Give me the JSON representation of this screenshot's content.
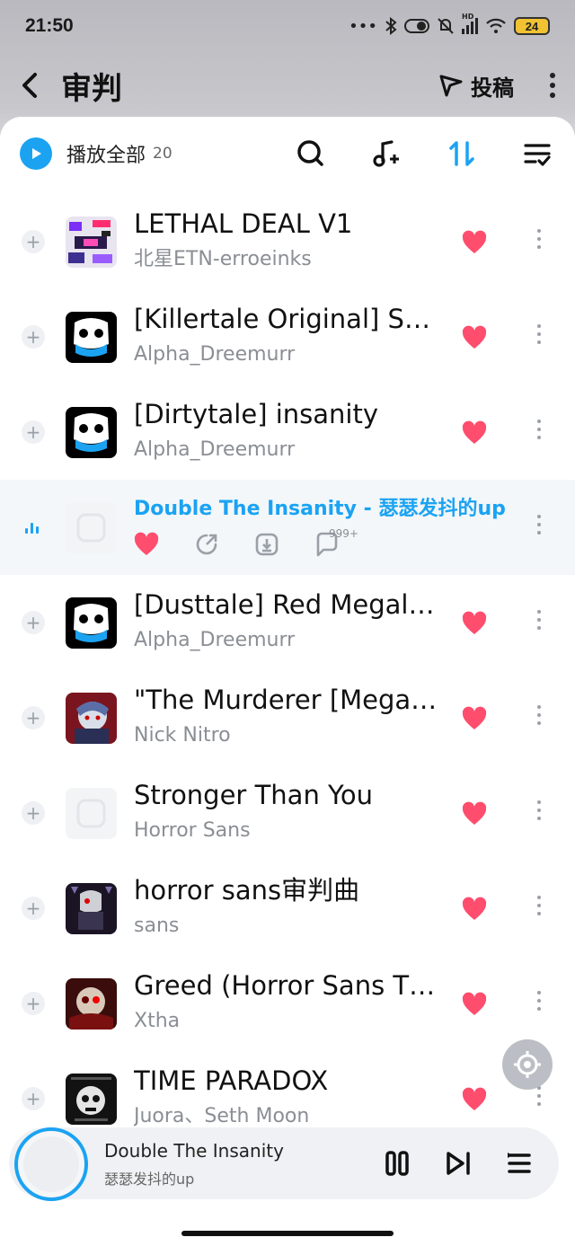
{
  "status": {
    "time": "21:50",
    "dots": "•••",
    "battery": "24",
    "hd_label": "HD"
  },
  "header": {
    "title": "审判",
    "post_label": "投稿"
  },
  "toolbar": {
    "play_all_label": "播放全部",
    "count": "20"
  },
  "songs": [
    {
      "title": "LETHAL DEAL V1",
      "artist": "北星ETN-erroeinks",
      "cover": "glitch-art",
      "liked": true
    },
    {
      "title": "[Killertale Original] S…",
      "artist": "Alpha_Dreemurr",
      "cover": "sans-skull",
      "liked": true
    },
    {
      "title": "[Dirtytale] insanity",
      "artist": "Alpha_Dreemurr",
      "cover": "sans-skull",
      "liked": true
    },
    {
      "title": "Double The Insanity - 瑟瑟发抖的up",
      "artist": "",
      "cover": "kugou-placeholder",
      "playing": true,
      "comment_count": "999+"
    },
    {
      "title": "[Dusttale] Red Megal…",
      "artist": "Alpha_Dreemurr",
      "cover": "sans-skull",
      "liked": true
    },
    {
      "title": "\"The Murderer [Mega…",
      "artist": "Nick Nitro",
      "cover": "anime-character",
      "liked": true
    },
    {
      "title": "Stronger Than You",
      "artist": "Horror Sans",
      "cover": "kugou-placeholder",
      "liked": true
    },
    {
      "title": "horror sans审判曲",
      "artist": "sans",
      "cover": "dark-character",
      "liked": true
    },
    {
      "title": "Greed (Horror Sans T…",
      "artist": "Xtha",
      "cover": "red-skull-art",
      "liked": true
    },
    {
      "title": "TIME PARADOX",
      "artist": "Juora、Seth Moon",
      "cover": "skull-album",
      "liked": true
    }
  ],
  "mini_player": {
    "title": "Double The Insanity",
    "artist": "瑟瑟发抖的up"
  },
  "colors": {
    "accent": "#1ba3f2",
    "heart": "#ff4d6d"
  }
}
